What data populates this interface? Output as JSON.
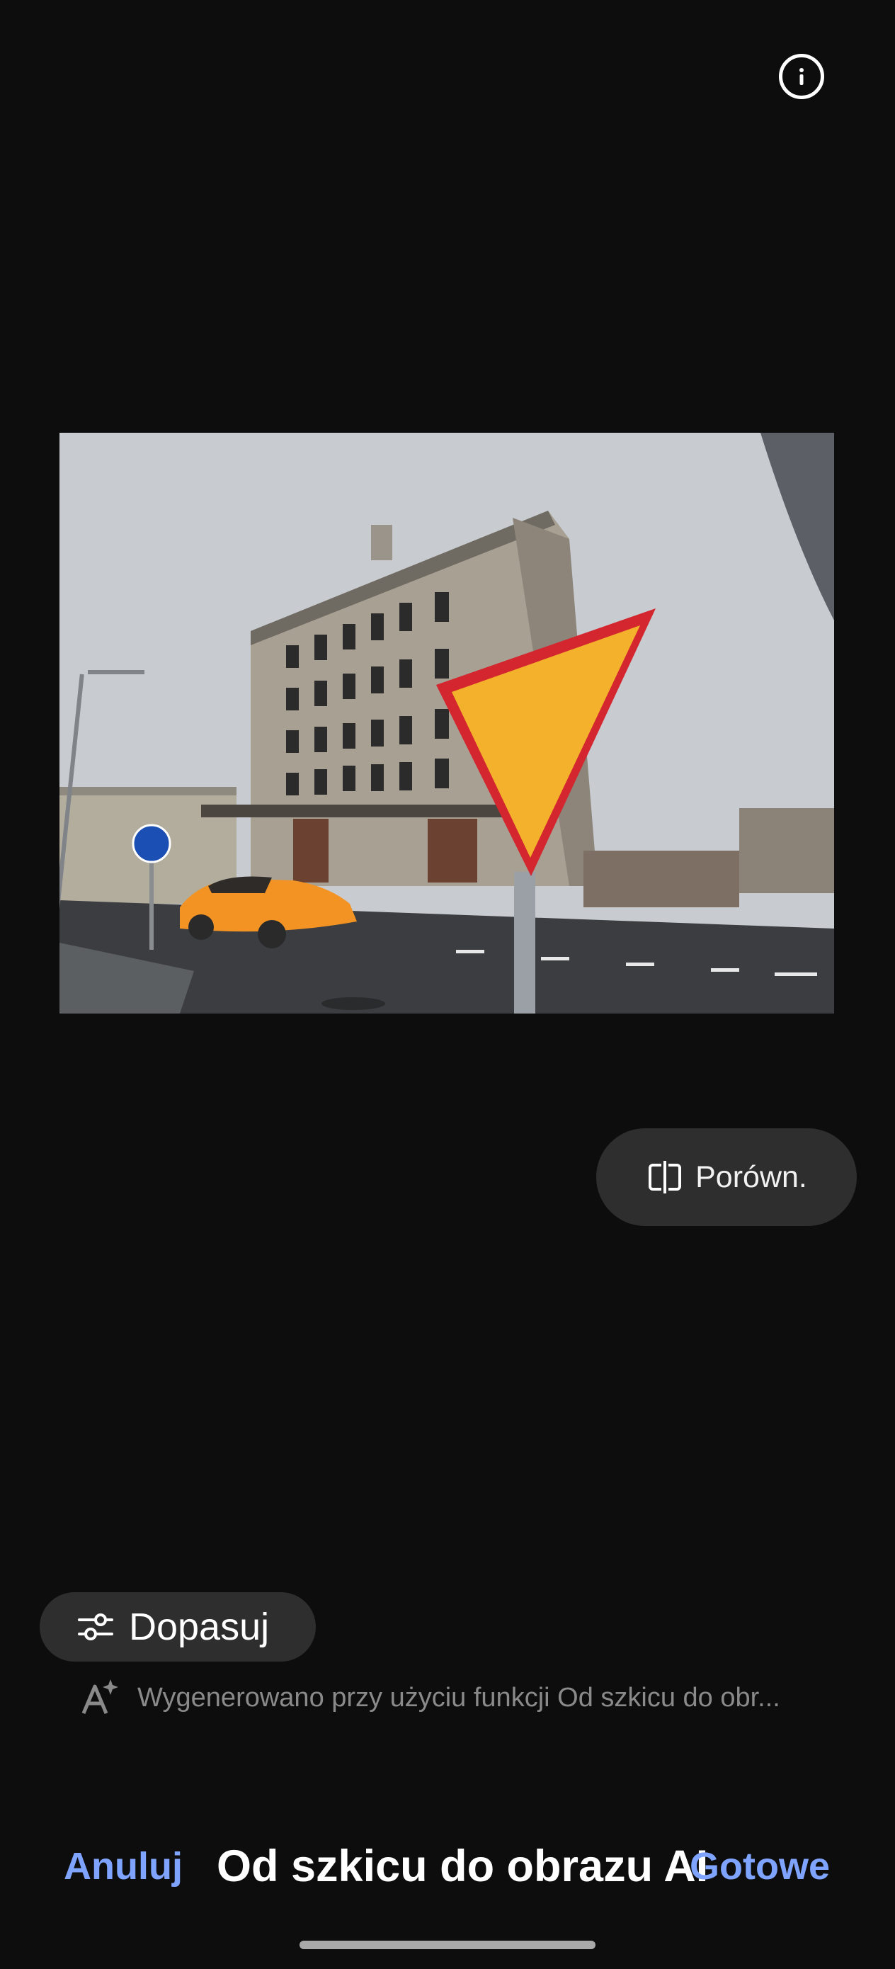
{
  "header": {
    "info_icon": "info-circle-icon"
  },
  "preview": {
    "image_subject": "Old building with yield sign and orange car"
  },
  "compare": {
    "icon": "compare-split-icon",
    "label": "Porówn."
  },
  "adjust": {
    "icon": "sliders-icon",
    "label": "Dopasuj"
  },
  "ai_note": {
    "icon": "ai-sparkle-icon",
    "text": "Wygenerowano przy użyciu funkcji Od szkicu do obr..."
  },
  "bottom_bar": {
    "cancel_label": "Anuluj",
    "title": "Od szkicu do obrazu AI",
    "done_label": "Gotowe"
  },
  "colors": {
    "background": "#0d0d0d",
    "accent": "#7fa4ff",
    "pill": "#2e2e2e"
  }
}
